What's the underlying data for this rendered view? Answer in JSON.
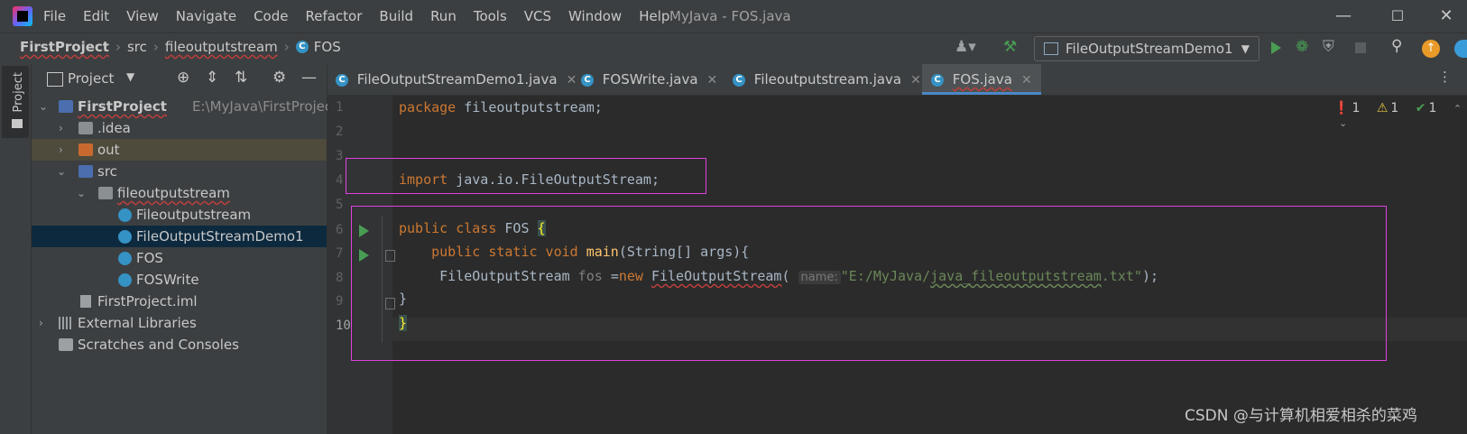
{
  "window": {
    "title": "MyJava - FOS.java",
    "menu": [
      "File",
      "Edit",
      "View",
      "Navigate",
      "Code",
      "Refactor",
      "Build",
      "Run",
      "Tools",
      "VCS",
      "Window",
      "Help"
    ]
  },
  "breadcrumb": [
    "FirstProject",
    "src",
    "fileoutputstream",
    "FOS"
  ],
  "toolbar": {
    "run_config": "FileOutputStreamDemo1"
  },
  "side_tab": "Project",
  "project_panel": {
    "title": "Project",
    "root_name": "FirstProject",
    "root_path": "E:\\MyJava\\FirstProject",
    "items": [
      ".idea",
      "out",
      "src",
      "fileoutputstream",
      "Fileoutputstream",
      "FileOutputStreamDemo1",
      "FOS",
      "FOSWrite",
      "FirstProject.iml",
      "External Libraries",
      "Scratches and Consoles"
    ]
  },
  "tabs": [
    "FileOutputStreamDemo1.java",
    "FOSWrite.java",
    "Fileoutputstream.java",
    "FOS.java"
  ],
  "editor": {
    "line_numbers": [
      "1",
      "2",
      "3",
      "4",
      "5",
      "6",
      "7",
      "8",
      "9",
      "10"
    ],
    "line1": {
      "kw": "package",
      "rest": " fileoutputstream;"
    },
    "line4": {
      "kw": "import",
      "rest": " java.io.FileOutputStream;"
    },
    "line6": {
      "kw": "public class",
      "name": " FOS ",
      "brace": "{"
    },
    "line7": {
      "indent": "    ",
      "kw": "public static void",
      "name": " main",
      "rest": "(String[] args){"
    },
    "line8": {
      "indent": "     ",
      "type": "FileOutputStream",
      "var": " fos ",
      "eq": "=",
      "kw": "new",
      "sp": " ",
      "ctor": "FileOutputStream",
      "paren": "(",
      "hint": "name:",
      "str_prefix": "\"E:/MyJava/",
      "str_underlined": "java_fileoutputstream",
      "str_suffix": ".txt\"",
      "close": ");"
    },
    "line9": "}",
    "line10": "}"
  },
  "problems": {
    "errors": "1",
    "warnings": "1",
    "ok": "1"
  },
  "watermark": "CSDN @与计算机相爱相杀的菜鸡"
}
